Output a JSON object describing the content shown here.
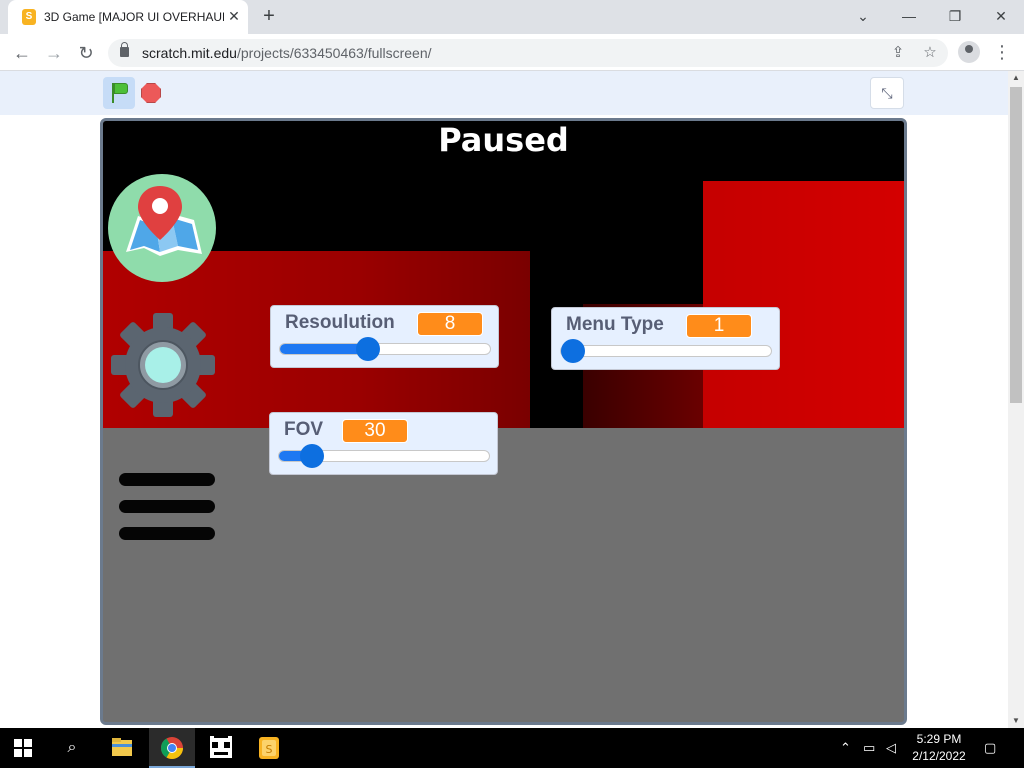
{
  "browser": {
    "tab_title": "3D Game [MAJOR UI OVERHAUL",
    "tab_favicon": "scratch-favicon",
    "url_host": "scratch.mit.edu",
    "url_path": "/projects/633450463/fullscreen/",
    "icons": [
      "back-arrow-icon",
      "forward-arrow-icon",
      "reload-icon",
      "lock-icon",
      "share-icon",
      "star-icon",
      "profile-icon",
      "kebab-menu-icon",
      "minimize-icon",
      "restore-icon",
      "close-icon"
    ]
  },
  "stage_controls": {
    "green_flag": "green-flag-icon",
    "stop": "stop-sign-icon",
    "exit_fullscreen": "exit-fullscreen-icon"
  },
  "game": {
    "title": "Paused",
    "icons": [
      "map-pin-icon",
      "gear-icon",
      "hamburger-menu-icon"
    ],
    "colors": {
      "wall_red": "#c00000",
      "floor_gray": "#707070",
      "sky": "#000000",
      "map_bg": "#8fdcab",
      "gear": "#5b6570",
      "gear_center": "#a8f0e8"
    }
  },
  "monitors": [
    {
      "label": "Resoulution",
      "value": "8",
      "slider_fraction": 0.36
    },
    {
      "label": "Menu Type",
      "value": "1",
      "slider_fraction": 0.0
    },
    {
      "label": "FOV",
      "value": "30",
      "slider_fraction": 0.1
    }
  ],
  "taskbar": {
    "time": "5:29 PM",
    "date": "2/12/2022",
    "apps": [
      "file-explorer-icon",
      "chrome-icon",
      "game-app-icon",
      "scratch-app-icon"
    ]
  }
}
